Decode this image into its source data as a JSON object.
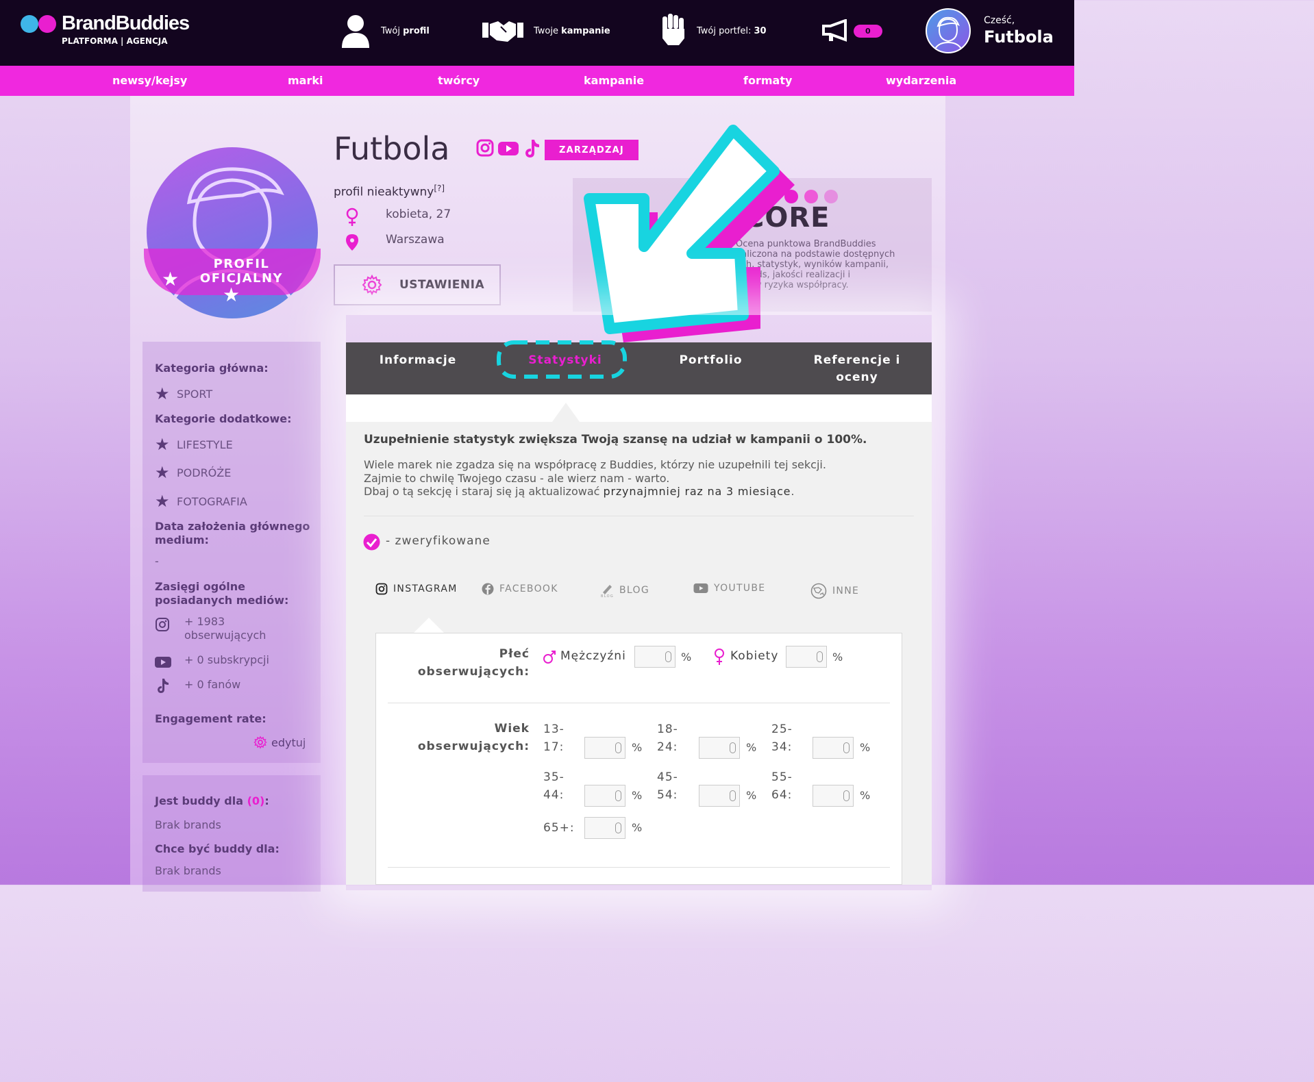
{
  "brand": {
    "name": "BrandBuddies",
    "sub": "PLATFORMA | AGENCJA",
    "colors": {
      "cyan": "#3fb6e8",
      "magenta": "#e91fcf",
      "dark": "#13051f"
    }
  },
  "header": {
    "profile_pre": "Twój ",
    "profile_bold": "profil",
    "campaigns_pre": "Twoje ",
    "campaigns_bold": "kampanie",
    "wallet_pre": "Twój portfel: ",
    "wallet_bold": "30",
    "notifications": "0",
    "greeting": "Cześć,",
    "user": "Futbola"
  },
  "nav": [
    "newsy/kejsy",
    "marki",
    "twórcy",
    "kampanie",
    "formaty",
    "wydarzenia"
  ],
  "profile": {
    "name": "Futbola",
    "status": "profil nieaktywny",
    "status_sup": "[?]",
    "gender_age": "kobieta, 27",
    "city": "Warszawa",
    "manage": "ZARZĄDZAJ",
    "settings": "USTAWIENIA",
    "badge": "PROFIL OFICJALNY",
    "score_word": "CORE",
    "score_label": "Y",
    "score_text": "Ocena punktowa BrandBuddies\nnaliczona na podstawie dostępnych\nych, statystyk, wyników kampanii,\nBrands, jakości realizacji i\nników ryzyka współpracy."
  },
  "sidebar": {
    "main_cat_label": "Kategoria główna:",
    "main_cat": "SPORT",
    "extra_cat_label": "Kategorie dodatkowe:",
    "extra_cats": [
      "LIFESTYLE",
      "PODRÓŻE",
      "FOTOGRAFIA"
    ],
    "founded_label": "Data założenia głównego medium:",
    "founded_value": "-",
    "reach_label": "Zasięgi ogólne posiadanych mediów:",
    "reach": {
      "instagram": "+ 1983 obserwujących",
      "youtube": "+ 0 subskrypcji",
      "tiktok": "+ 0 fanów"
    },
    "engagement_label": "Engagement rate:",
    "edit": "edytuj",
    "buddy_for_label": "Jest buddy dla ",
    "buddy_for_count": "(0)",
    "buddy_for_colon": ":",
    "buddy_for_value": "Brak brands",
    "want_buddy_label": "Chce być buddy dla:",
    "want_buddy_value": "Brak brands"
  },
  "tabs": {
    "info": "Informacje",
    "stats": "Statystyki",
    "portfolio": "Portfolio",
    "refs_1": "Referencje i",
    "refs_2": "oceny"
  },
  "stats": {
    "headline": "Uzupełnienie statystyk zwiększa Twoją szansę na udział w kampanii o 100%.",
    "line1": "Wiele marek nie zgadza się na współpracę z Buddies, którzy nie uzupełnili tej sekcji.",
    "line2": "Zajmie to chwilę Twojego czasu - ale wierz nam - warto.",
    "line3_pre": "Dbaj o tą sekcję i staraj się ją aktualizować ",
    "line3_bold": "przynajmniej raz na 3 miesiące",
    "line3_end": ".",
    "verified": "- zweryfikowane",
    "media_tabs": [
      "INSTAGRAM",
      "FACEBOOK",
      "BLOG",
      "YOUTUBE",
      "INNE"
    ],
    "gender_label_1": "Płeć",
    "gender_label_2": "obserwujących:",
    "men": "Mężczyźni",
    "women": "Kobiety",
    "age_label_1": "Wiek",
    "age_label_2": "obserwujących:",
    "ages": [
      {
        "a": "13-",
        "b": "17:"
      },
      {
        "a": "18-",
        "b": "24:"
      },
      {
        "a": "25-",
        "b": "34:"
      },
      {
        "a": "35-",
        "b": "44:"
      },
      {
        "a": "45-",
        "b": "54:"
      },
      {
        "a": "55-",
        "b": "64:"
      },
      {
        "a": "",
        "b": "65+:"
      }
    ],
    "pct": "%"
  }
}
